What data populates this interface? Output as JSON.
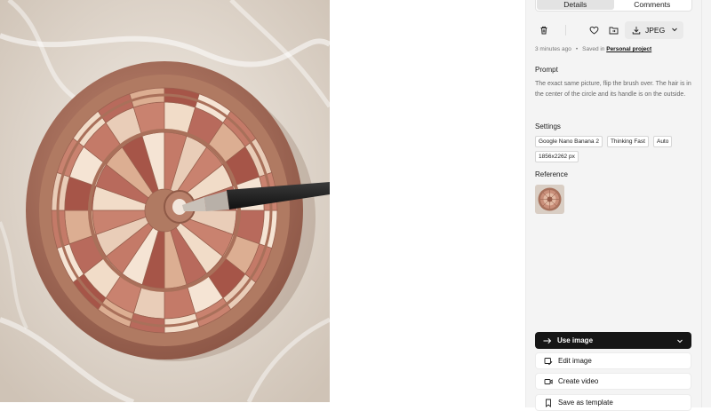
{
  "tabs": [
    {
      "label": "Details",
      "active": true
    },
    {
      "label": "Comments",
      "active": false
    }
  ],
  "toolbar": {
    "delete_icon": "trash-icon",
    "favorite_icon": "heart-icon",
    "move_icon": "folder-move-icon",
    "download_label": "JPEG",
    "download_icon": "download-icon"
  },
  "meta": {
    "time": "3 minutes ago",
    "saved_prefix": "Saved in",
    "project": "Personal project"
  },
  "prompt": {
    "title": "Prompt",
    "text": "The exact same picture, flip the brush over. The hair is in the center of the circle and its handle is on the outside."
  },
  "settings": {
    "title": "Settings",
    "chips": [
      "Google Nano Banana 2",
      "Thinking Fast",
      "Auto",
      "1856x2262 px"
    ]
  },
  "reference": {
    "title": "Reference"
  },
  "actions": {
    "use_image": "Use image",
    "edit_image": "Edit image",
    "create_video": "Create video",
    "save_template": "Save as template"
  },
  "colors": {
    "primary_button": "#161616",
    "panel_bg": "#f4f4f4",
    "image_bg": "#e6ddd2",
    "palette_rim": "#a8715c"
  }
}
